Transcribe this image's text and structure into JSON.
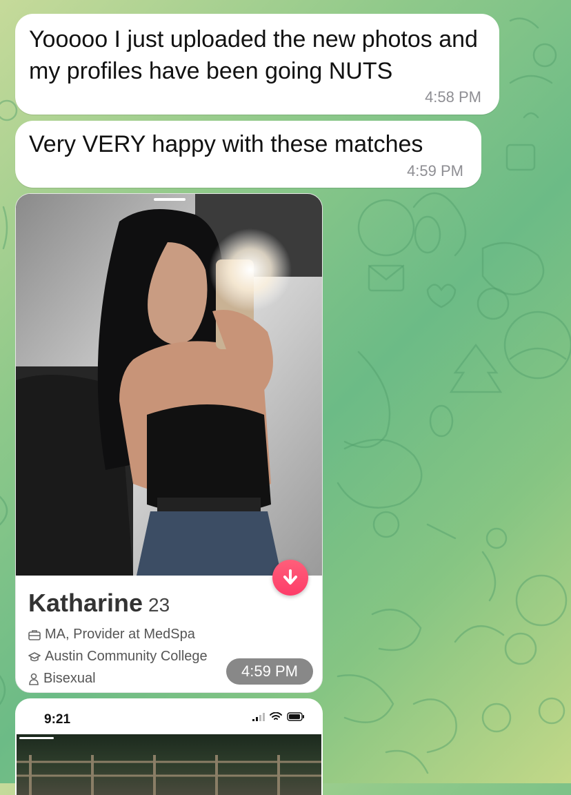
{
  "messages": [
    {
      "text": "Yooooo I just uploaded the new photos and my profiles have been going NUTS",
      "time": "4:58 PM"
    },
    {
      "text": "Very VERY happy with these matches",
      "time": "4:59 PM"
    }
  ],
  "profile_card": {
    "name": "Katharine",
    "age": "23",
    "job": "MA, Provider at MedSpa",
    "school": "Austin Community College",
    "orientation": "Bisexual",
    "time": "4:59 PM",
    "icons": {
      "job": "briefcase-icon",
      "school": "graduation-cap-icon",
      "orientation": "person-icon",
      "info_button": "arrow-down-icon"
    },
    "accent_color": "#fd3c69"
  },
  "second_card": {
    "status_time": "9:21",
    "icons": [
      "signal-icon",
      "wifi-icon",
      "battery-icon"
    ]
  },
  "colors": {
    "chat_gradient_start": "#c6da9a",
    "chat_gradient_mid": "#6cbb86",
    "bubble": "#ffffff"
  }
}
